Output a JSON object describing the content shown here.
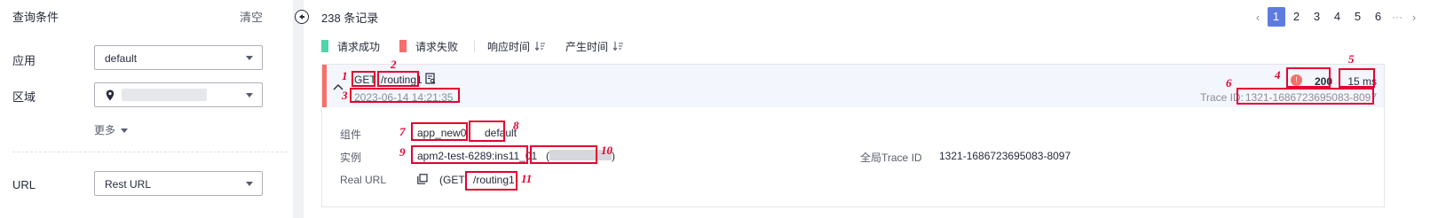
{
  "filter": {
    "title": "查询条件",
    "clear_label": "清空",
    "app_label": "应用",
    "app_value": "default",
    "region_label": "区域",
    "more_label": "更多",
    "url_label": "URL",
    "url_value": "Rest URL"
  },
  "list": {
    "count_text": "238 条记录",
    "pagination": {
      "prev": "‹",
      "pages": [
        "1",
        "2",
        "3",
        "4",
        "5",
        "6"
      ],
      "current": "1",
      "ellipsis": "···",
      "next": "›"
    },
    "legend": {
      "success_label": "请求成功",
      "success_color": "#50d4ab",
      "fail_label": "请求失败",
      "fail_color": "#f66f6a",
      "sort_response_time": "响应时间",
      "sort_created_time": "产生时间"
    }
  },
  "record": {
    "method": "GET",
    "path": "/routing1",
    "time": "2023-06-14 14:21:35",
    "status_icon": "!",
    "status": "200",
    "duration": "15 ms",
    "trace_label": "Trace ID:",
    "trace_id": "1321-1686723695083-8097",
    "details": {
      "component_label": "组件",
      "component_name": "app_new0",
      "component_env": "default",
      "instance_label": "实例",
      "instance_name": "apm2-test-6289:ins11_01",
      "instance_ip_open": "(",
      "instance_ip_close": ")",
      "global_trace_label": "全局Trace ID",
      "global_trace_value": "1321-1686723695083-8097",
      "real_url_label": "Real URL",
      "real_url_method": "(GET",
      "real_url_path": "/routing1"
    }
  },
  "annotations": [
    "1",
    "2",
    "3",
    "4",
    "5",
    "6",
    "7",
    "8",
    "9",
    "10",
    "11"
  ]
}
